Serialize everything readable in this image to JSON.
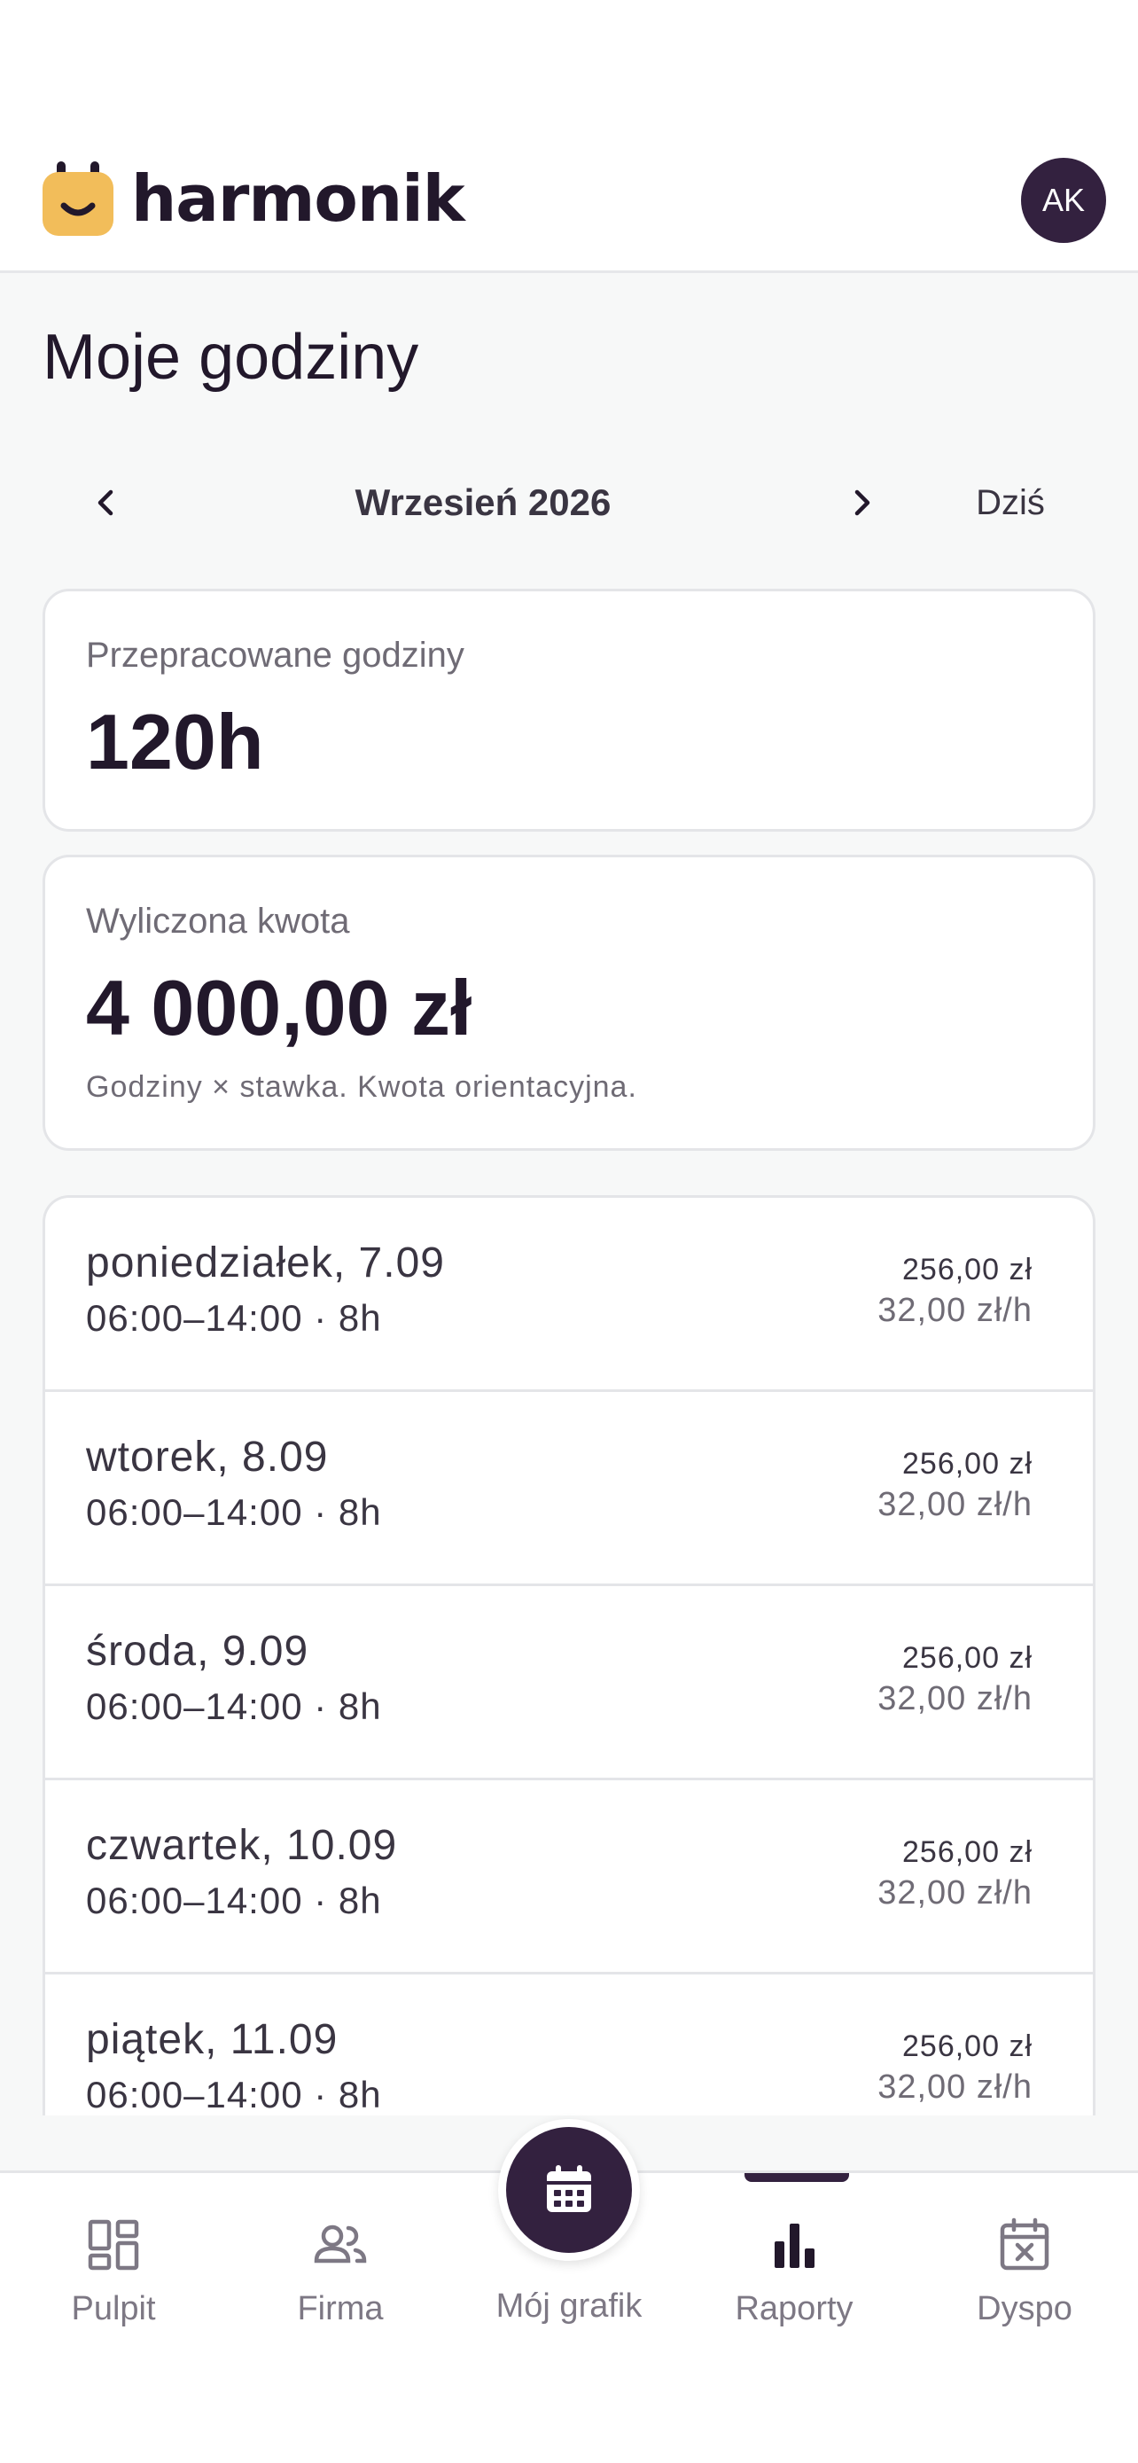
{
  "header": {
    "brand": "harmonik",
    "logo_icon": "smiley-plug-icon",
    "avatar_initials": "AK"
  },
  "page": {
    "title": "Moje godziny"
  },
  "month_nav": {
    "label": "Wrzesień 2026",
    "today_label": "Dziś"
  },
  "summary": {
    "hours_label": "Przepracowane godziny",
    "hours_value": "120h",
    "amount_label": "Wyliczona kwota",
    "amount_value": "4 000,00 zł",
    "amount_note": "Godziny × stawka. Kwota orientacyjna."
  },
  "entries": [
    {
      "day": "poniedziałek, 7.09",
      "time": "06:00–14:00 · 8h",
      "amount": "256,00 zł",
      "rate": "32,00 zł/h"
    },
    {
      "day": "wtorek, 8.09",
      "time": "06:00–14:00 · 8h",
      "amount": "256,00 zł",
      "rate": "32,00 zł/h"
    },
    {
      "day": "środa, 9.09",
      "time": "06:00–14:00 · 8h",
      "amount": "256,00 zł",
      "rate": "32,00 zł/h"
    },
    {
      "day": "czwartek, 10.09",
      "time": "06:00–14:00 · 8h",
      "amount": "256,00 zł",
      "rate": "32,00 zł/h"
    },
    {
      "day": "piątek, 11.09",
      "time": "06:00–14:00 · 8h",
      "amount": "256,00 zł",
      "rate": "32,00 zł/h"
    }
  ],
  "bottom_nav": {
    "items": [
      {
        "label": "Pulpit",
        "icon": "dashboard-icon"
      },
      {
        "label": "Firma",
        "icon": "users-icon"
      },
      {
        "label": "Mój grafik",
        "icon": "calendar-icon"
      },
      {
        "label": "Raporty",
        "icon": "bar-chart-icon",
        "active": true
      },
      {
        "label": "Dyspo",
        "icon": "calendar-x-icon"
      }
    ]
  },
  "colors": {
    "primary": "#33213f",
    "logo_yellow": "#f2bd5a",
    "text": "#22182b",
    "muted": "#6f6b75",
    "background": "#f7f8f8"
  }
}
